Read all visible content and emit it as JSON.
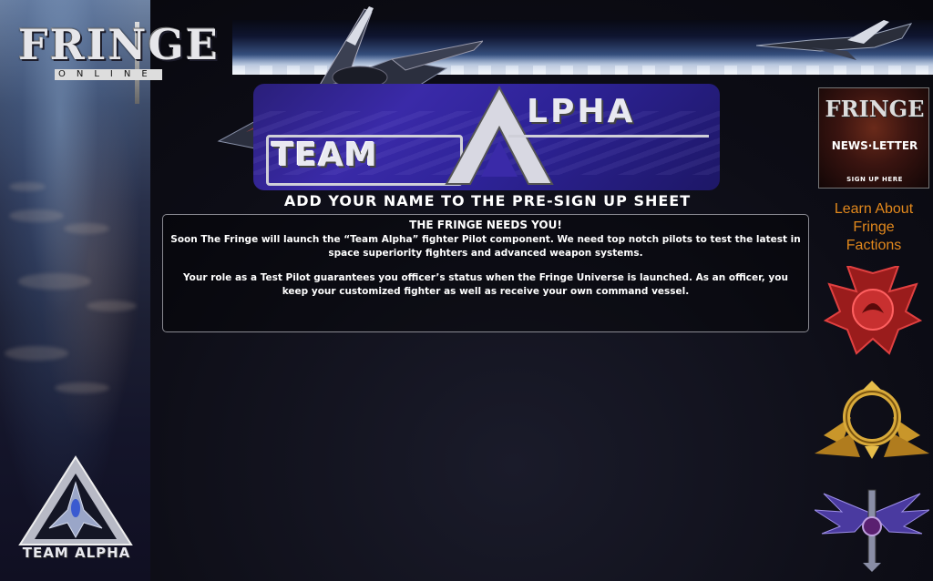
{
  "site": {
    "logo_text": "FRINGE",
    "logo_sub": "ONLINE"
  },
  "banner": {
    "team": "TEAM",
    "alpha": "LPHA"
  },
  "headline": "ADD YOUR NAME TO THE PRE-SIGN UP SHEET",
  "message": {
    "title": "THE FRINGE NEEDS YOU!",
    "paragraph1": "Soon The Fringe will launch the “Team Alpha” fighter Pilot component. We need top notch pilots to test the latest in space superiority fighters and advanced weapon systems.",
    "paragraph2": "Your role as a Test Pilot guarantees you officer’s status when the Fringe Universe is launched. As an officer, you keep your customized fighter as well as receive your own command vessel."
  },
  "sidebar": {
    "newsletter": {
      "logo": "FRINGE",
      "news": "NEWS·LETTER",
      "signup": "SIGN UP HERE"
    },
    "learn_link": [
      "Learn About",
      "Fringe",
      "Factions"
    ]
  },
  "badge": {
    "text": "TEAM ALPHA"
  },
  "colors": {
    "link_orange": "#e2881c",
    "banner_purple": "#3a2aa8",
    "background": "#0b0a14"
  }
}
